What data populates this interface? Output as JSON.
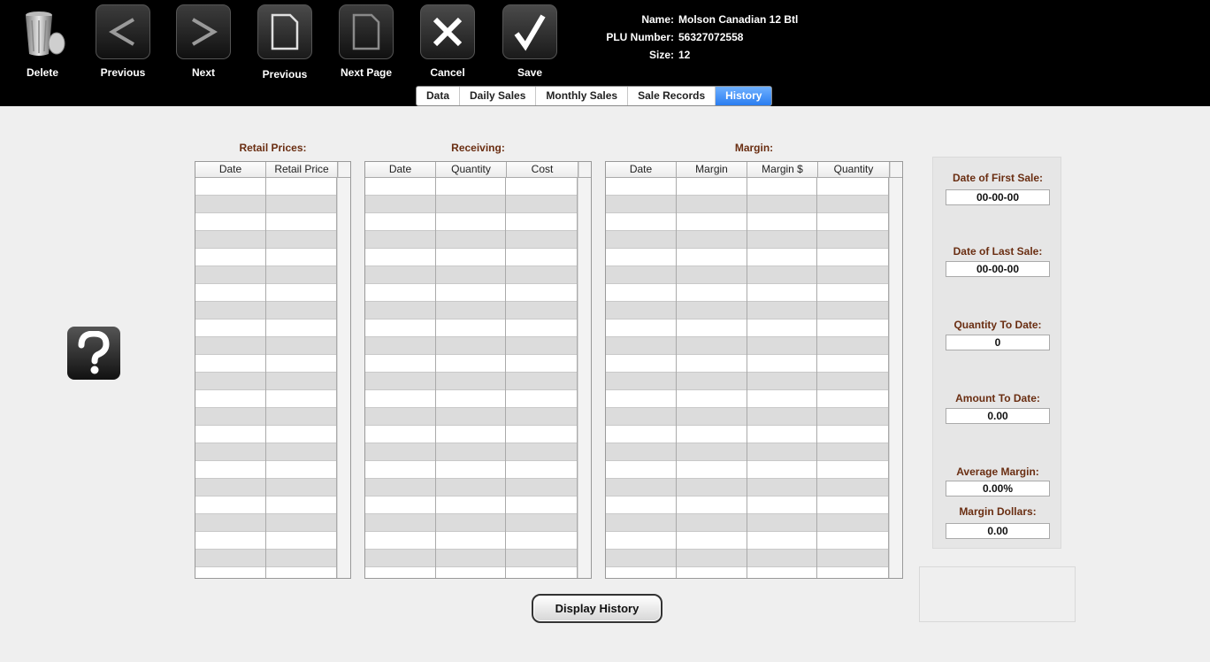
{
  "toolbar": {
    "delete_label": "Delete",
    "previous_label": "Previous",
    "next_label": "Next",
    "previous_page_label": "Previous",
    "next_page_label": "Next Page",
    "cancel_label": "Cancel",
    "save_label": "Save"
  },
  "product": {
    "name_label": "Name:",
    "name_value": "Molson Canadian 12 Btl",
    "plu_label": "PLU Number:",
    "plu_value": "56327072558",
    "size_label": "Size:",
    "size_value": "12"
  },
  "tabs": [
    {
      "label": "Data",
      "active": false
    },
    {
      "label": "Daily Sales",
      "active": false
    },
    {
      "label": "Monthly Sales",
      "active": false
    },
    {
      "label": "Sale Records",
      "active": false
    },
    {
      "label": "History",
      "active": true
    }
  ],
  "retail": {
    "title": "Retail Prices:",
    "headers": [
      "Date",
      "Retail Price"
    ]
  },
  "receiving": {
    "title": "Receiving:",
    "headers": [
      "Date",
      "Quantity",
      "Cost"
    ]
  },
  "margin": {
    "title": "Margin:",
    "headers": [
      "Date",
      "Margin",
      "Margin $",
      "Quantity"
    ]
  },
  "stats": {
    "first_sale_label": "Date of First Sale:",
    "first_sale_value": "00-00-00",
    "last_sale_label": "Date of Last Sale:",
    "last_sale_value": "00-00-00",
    "qty_label": "Quantity To Date:",
    "qty_value": "0",
    "amount_label": "Amount To Date:",
    "amount_value": "0.00",
    "avg_margin_label": "Average Margin:",
    "avg_margin_value": "0.00%",
    "margin_dollars_label": "Margin Dollars:",
    "margin_dollars_value": "0.00"
  },
  "display_history_label": "Display History",
  "help_icon": "question-mark-icon",
  "colors": {
    "accent_tab": "#2a7df0",
    "section_title": "#6a2e12"
  }
}
